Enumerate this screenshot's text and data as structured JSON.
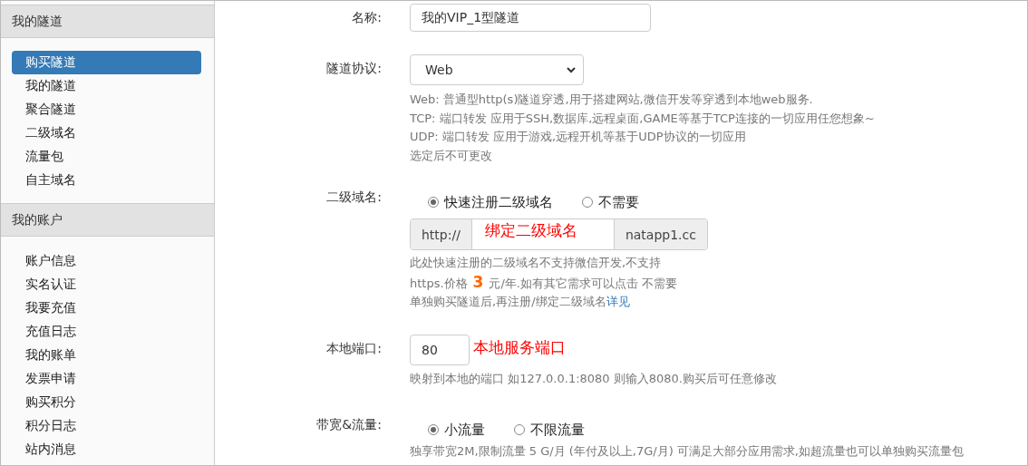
{
  "sidebar": {
    "sections": [
      {
        "title": "我的隧道",
        "items": [
          {
            "label": "购买隧道",
            "selected": true
          },
          {
            "label": "我的隧道",
            "selected": false
          },
          {
            "label": "聚合隧道",
            "selected": false
          },
          {
            "label": "二级域名",
            "selected": false
          },
          {
            "label": "流量包",
            "selected": false
          },
          {
            "label": "自主域名",
            "selected": false
          }
        ]
      },
      {
        "title": "我的账户",
        "items": [
          {
            "label": "账户信息",
            "selected": false
          },
          {
            "label": "实名认证",
            "selected": false
          },
          {
            "label": "我要充值",
            "selected": false
          },
          {
            "label": "充值日志",
            "selected": false
          },
          {
            "label": "我的账单",
            "selected": false
          },
          {
            "label": "发票申请",
            "selected": false
          },
          {
            "label": "购买积分",
            "selected": false
          },
          {
            "label": "积分日志",
            "selected": false
          },
          {
            "label": "站内消息",
            "selected": false
          }
        ]
      }
    ]
  },
  "form": {
    "name": {
      "label": "名称:",
      "value": "我的VIP_1型隧道"
    },
    "protocol": {
      "label": "隧道协议:",
      "value": "Web",
      "help": [
        "Web: 普通型http(s)隧道穿透,用于搭建网站,微信开发等穿透到本地web服务.",
        "TCP: 端口转发 应用于SSH,数据库,远程桌面,GAME等基于TCP连接的一切应用任您想象~",
        "UDP: 端口转发 应用于游戏,远程开机等基于UDP协议的一切应用",
        "选定后不可更改"
      ]
    },
    "subdomain": {
      "label": "二级域名:",
      "options": [
        {
          "label": "快速注册二级域名",
          "selected": true
        },
        {
          "label": "不需要",
          "selected": false
        }
      ],
      "prefix": "http://",
      "annotation": "绑定二级域名",
      "suffix": "natapp1.cc",
      "help_line_1": "此处快速注册的二级域名不支持微信开发,不支持",
      "help_line_2_before": "https.价格",
      "price": "3",
      "help_line_2_after": "元/年.如有其它需求可以点击 不需要",
      "help_line_3": "单独购买隧道后,再注册/绑定二级域名",
      "link": "详见"
    },
    "port": {
      "label": "本地端口:",
      "value": "80",
      "annotation": "本地服务端口",
      "help": "映射到本地的端口 如127.0.0.1:8080 则输入8080.购买后可任意修改"
    },
    "bandwidth": {
      "label": "带宽&流量:",
      "options": [
        {
          "label": "小流量",
          "selected": true
        },
        {
          "label": "不限流量",
          "selected": false
        }
      ],
      "help": "独享带宽2M,限制流量 5 G/月 (年付及以上,7G/月) 可满足大部分应用需求,如超流量也可以单独购买流量包"
    }
  }
}
